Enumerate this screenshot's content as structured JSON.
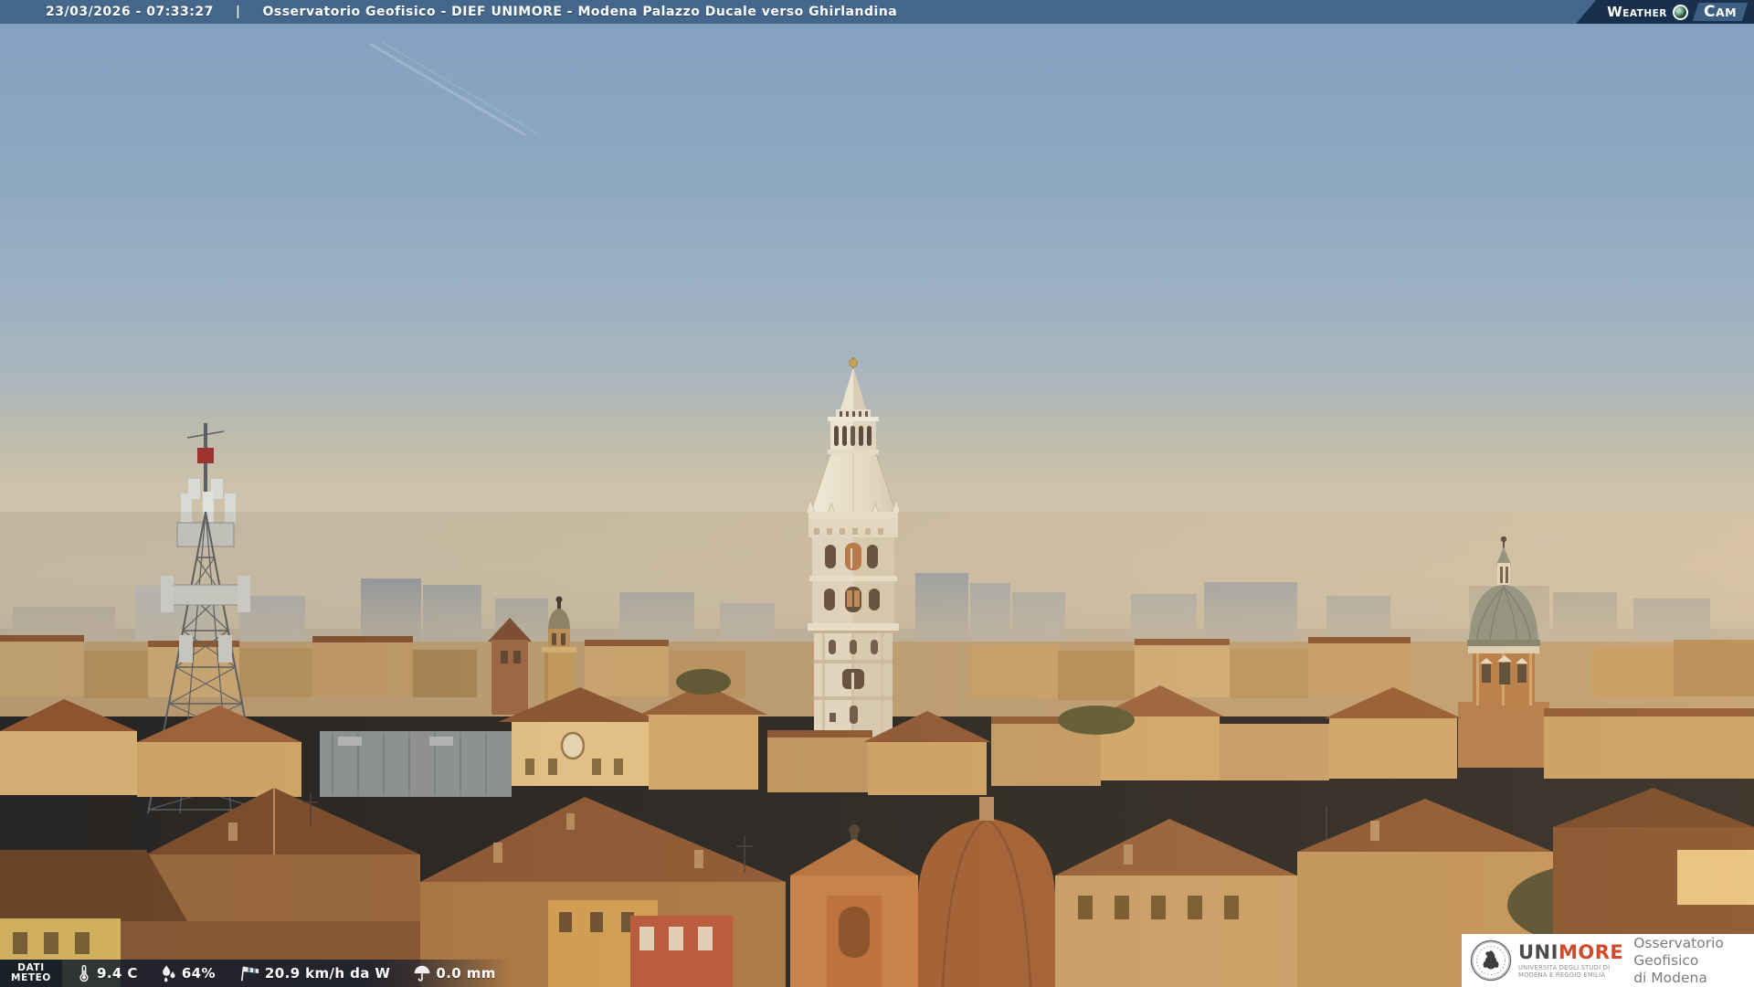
{
  "header": {
    "timestamp": "23/03/2026 - 07:33:27",
    "separator": "|",
    "title": "Osservatorio Geofisico - DIEF UNIMORE - Modena Palazzo Ducale verso Ghirlandina",
    "logo": {
      "weather": "Weather",
      "cam": "Cam"
    }
  },
  "meteo_bar": {
    "label_line1": "DATI",
    "label_line2": "METEO",
    "metrics": [
      {
        "name": "temperature",
        "icon": "thermometer-icon",
        "value": "9.4 C"
      },
      {
        "name": "humidity",
        "icon": "humidity-icon",
        "value": "64%"
      },
      {
        "name": "wind",
        "icon": "windsock-icon",
        "value": "20.9 km/h da W"
      },
      {
        "name": "precipitation",
        "icon": "umbrella-icon",
        "value": "0.0 mm"
      }
    ]
  },
  "branding": {
    "acronym_uni": "UNI",
    "acronym_more": "MORE",
    "university_line1": "UNIVERSITÀ DEGLI STUDI DI",
    "university_line2": "MODENA E REGGIO EMILIA",
    "org_line1": "Osservatorio Geofisico",
    "org_line2": "di Modena"
  },
  "colors": {
    "header_bar": "#44678b",
    "logo_navy": "#182f4d",
    "cam_chip_blue": "#3d5f82",
    "footer_overlay": "#091626",
    "unimore_red": "#d14a2c",
    "text_gray": "#7c7c7c"
  }
}
